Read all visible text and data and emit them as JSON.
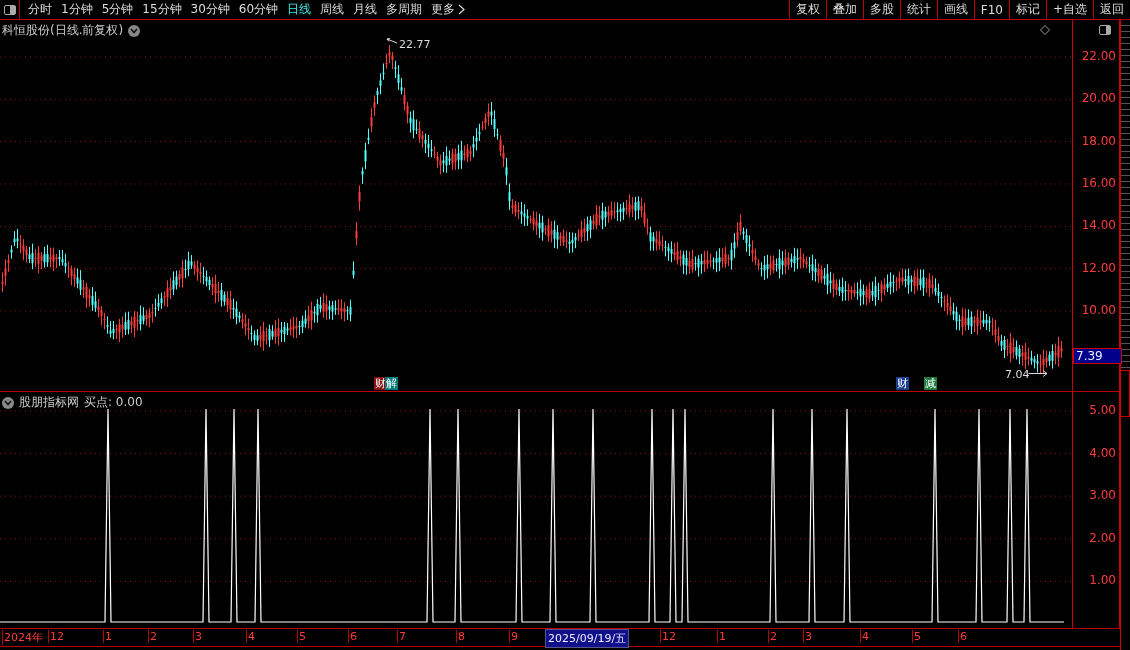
{
  "toolbar": {
    "periods": [
      {
        "label": "分时",
        "selected": false
      },
      {
        "label": "1分钟",
        "selected": false
      },
      {
        "label": "5分钟",
        "selected": false
      },
      {
        "label": "15分钟",
        "selected": false
      },
      {
        "label": "30分钟",
        "selected": false
      },
      {
        "label": "60分钟",
        "selected": false
      },
      {
        "label": "日线",
        "selected": true
      },
      {
        "label": "周线",
        "selected": false
      },
      {
        "label": "月线",
        "selected": false
      },
      {
        "label": "多周期",
        "selected": false
      },
      {
        "label": "更多",
        "selected": false
      }
    ],
    "actions": [
      "复权",
      "叠加",
      "多股",
      "统计",
      "画线",
      "F10",
      "标记",
      "+自选",
      "返回"
    ]
  },
  "chart": {
    "title": "科恒股份(日线.前复权)",
    "y_ticks": [
      "22.00",
      "20.00",
      "18.00",
      "16.00",
      "14.00",
      "12.00",
      "10.00"
    ],
    "high_label": "22.77",
    "low_label": "7.04",
    "current_price": "7.39",
    "events": [
      {
        "label": "财",
        "color": "#8b1010"
      },
      {
        "label": "解",
        "color": "#007878"
      },
      {
        "label": "财",
        "color": "#1c3f8f"
      },
      {
        "label": "减",
        "color": "#1e7a3a"
      }
    ]
  },
  "indicator": {
    "name": "股朋指标网",
    "reading": "买点: 0.00",
    "y_ticks": [
      "5.00",
      "4.00",
      "3.00",
      "2.00",
      "1.00"
    ]
  },
  "time_axis": {
    "labels": [
      "2024年",
      "12",
      "1",
      "2",
      "3",
      "4",
      "5",
      "6",
      "7",
      "8",
      "9",
      "12",
      "1",
      "2",
      "3",
      "4",
      "5",
      "6"
    ],
    "cursor_date": "2025/09/19/五"
  }
}
